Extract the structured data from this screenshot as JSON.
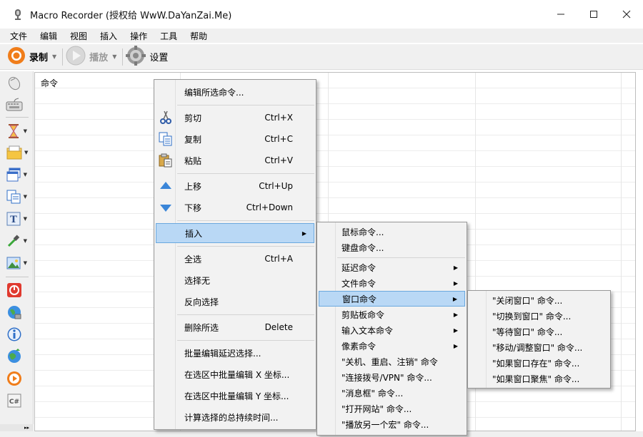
{
  "window": {
    "title": "Macro Recorder (授权给 WwW.DaYanZai.Me)",
    "minimize": "—",
    "maximize": "☐",
    "close": "✕"
  },
  "menubar": [
    "文件",
    "编辑",
    "视图",
    "插入",
    "操作",
    "工具",
    "帮助"
  ],
  "toolbar": {
    "record_label": "录制",
    "play_label": "播放",
    "settings_label": "设置",
    "dropdown_glyph": "▼"
  },
  "grid": {
    "column_header": "命令"
  },
  "context_menu": {
    "items": [
      {
        "label": "编辑所选命令...",
        "shortcut": ""
      },
      {
        "label": "剪切",
        "shortcut": "Ctrl+X"
      },
      {
        "label": "复制",
        "shortcut": "Ctrl+C"
      },
      {
        "label": "粘贴",
        "shortcut": "Ctrl+V"
      },
      {
        "label": "上移",
        "shortcut": "Ctrl+Up"
      },
      {
        "label": "下移",
        "shortcut": "Ctrl+Down"
      },
      {
        "label": "插入",
        "shortcut": ""
      },
      {
        "label": "全选",
        "shortcut": "Ctrl+A"
      },
      {
        "label": "选择无",
        "shortcut": ""
      },
      {
        "label": "反向选择",
        "shortcut": ""
      },
      {
        "label": "删除所选",
        "shortcut": "Delete"
      },
      {
        "label": "批量编辑延迟选择...",
        "shortcut": ""
      },
      {
        "label": "在选区中批量编辑 X 坐标...",
        "shortcut": ""
      },
      {
        "label": "在选区中批量编辑 Y 坐标...",
        "shortcut": ""
      },
      {
        "label": "计算选择的总持续时间...",
        "shortcut": ""
      }
    ],
    "submenu_arrow": "▶"
  },
  "insert_submenu": {
    "items": [
      "鼠标命令...",
      "键盘命令...",
      "延迟命令",
      "文件命令",
      "窗口命令",
      "剪贴板命令",
      "输入文本命令",
      "像素命令",
      "\"关机、重启、注销\" 命令",
      "\"连接拨号/VPN\" 命令...",
      "\"消息框\" 命令...",
      "\"打开网站\" 命令...",
      "\"播放另一个宏\" 命令..."
    ]
  },
  "window_submenu": {
    "items": [
      "\"关闭窗口\" 命令...",
      "\"切换到窗口\" 命令...",
      "\"等待窗口\" 命令...",
      "\"移动/调整窗口\" 命令...",
      "\"如果窗口存在\" 命令...",
      "\"如果窗口聚焦\" 命令..."
    ]
  },
  "icons": {
    "toolbox_more": "▸▸"
  },
  "colors": {
    "highlight": "#b9d8f5",
    "highlight_border": "#6aa8de",
    "record_orange": "#f07d1a"
  }
}
